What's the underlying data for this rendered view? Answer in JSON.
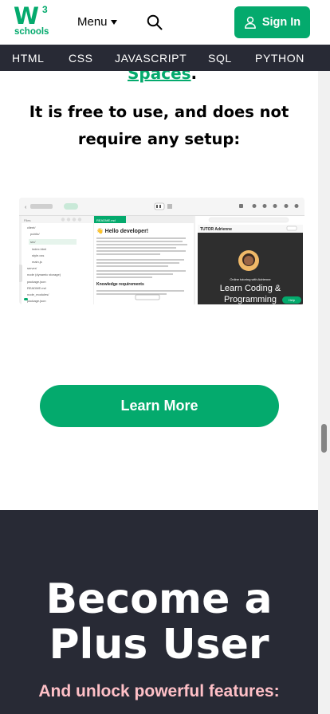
{
  "logo": {
    "mark": "W",
    "superscript": "3",
    "text": "schools"
  },
  "header": {
    "menu_label": "Menu",
    "signin_label": "Sign In"
  },
  "nav": {
    "items": [
      "HTML",
      "CSS",
      "JAVASCRIPT",
      "SQL",
      "PYTHON"
    ]
  },
  "content": {
    "spaces_link": "Spaces",
    "spaces_period": ".",
    "free_line1": "It is free to use, and does not",
    "free_line2": "require any setup:"
  },
  "preview": {
    "editor_file": "README.md",
    "heading": "Hello developer!",
    "section": "Knowledge requirements",
    "tutor_label": "TUTOR Adrienne",
    "tutor_caption": "Online tutoring with Adrienne",
    "tutor_big1": "Learn Coding &",
    "tutor_big2": "Programming",
    "help": "Help",
    "files": [
      "client/",
      "public/",
      "src/",
      "index.html",
      "style.css",
      "main.js",
      "server/",
      "package.json",
      "README.md",
      "node_modules/",
      "package.json"
    ]
  },
  "cta": {
    "learn_more": "Learn More"
  },
  "plus": {
    "line1": "Become a",
    "line2": "Plus User",
    "subtitle": "And unlock powerful features:"
  },
  "colors": {
    "brand_green": "#04AA6D",
    "dark_bg": "#282A35",
    "pink": "#FFC0C7"
  }
}
